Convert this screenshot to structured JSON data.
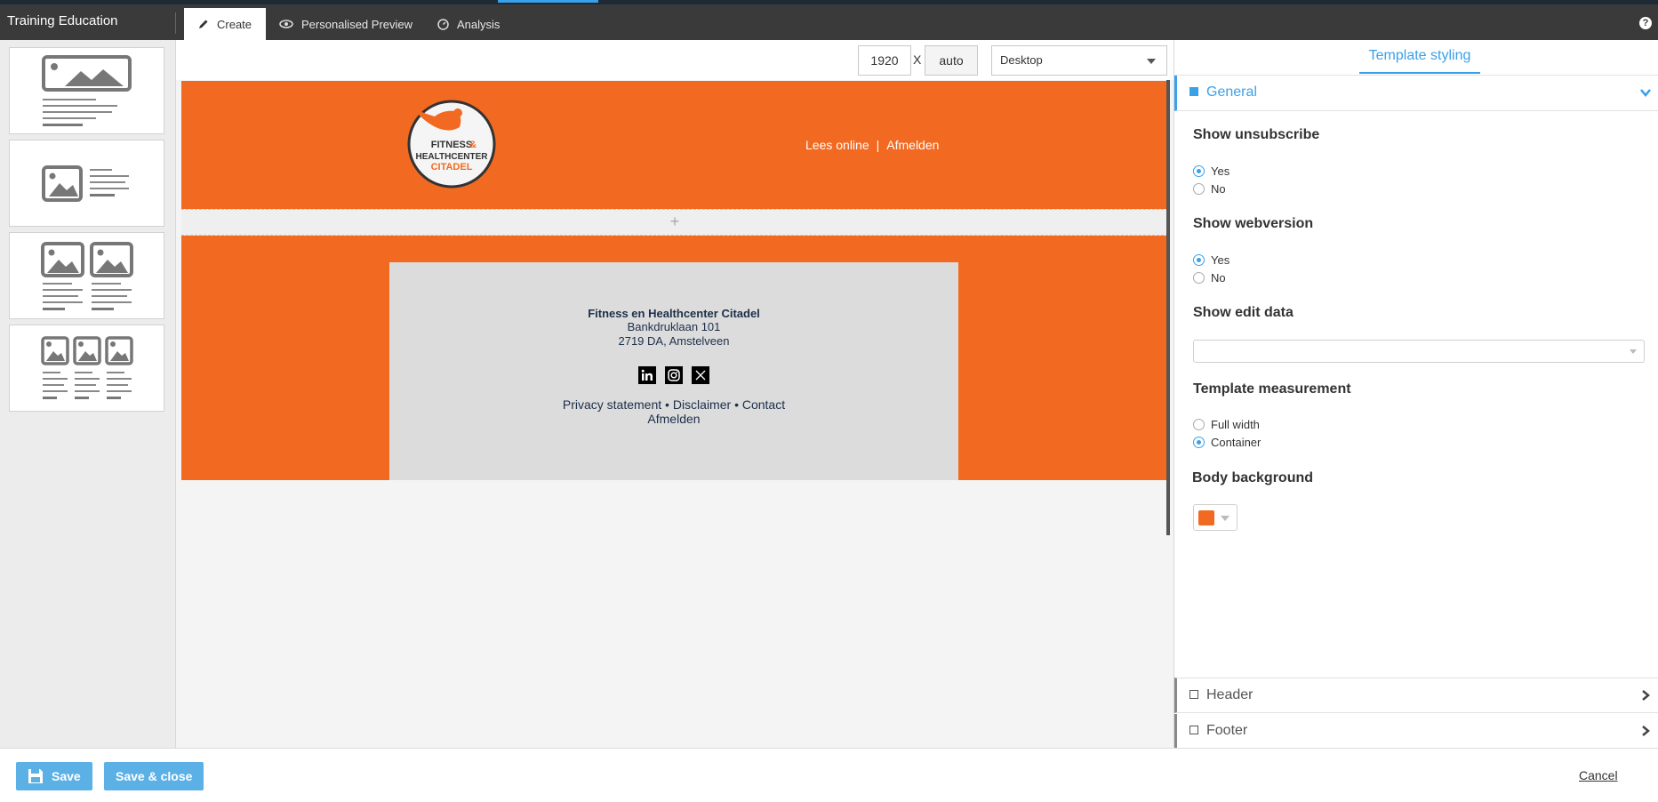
{
  "app": {
    "title": "Training Education",
    "help_label": "?"
  },
  "tabs": [
    {
      "label": "Create",
      "icon": "pencil-icon",
      "active": true
    },
    {
      "label": "Personalised Preview",
      "icon": "eye-icon",
      "active": false
    },
    {
      "label": "Analysis",
      "icon": "gauge-icon",
      "active": false
    }
  ],
  "canvas": {
    "width_value": "1920",
    "separator": "X",
    "height_value": "auto",
    "device": "Desktop"
  },
  "email": {
    "header_links": {
      "read_online": "Lees online",
      "pipe": "|",
      "unsubscribe": "Afmelden"
    },
    "add_row_symbol": "+",
    "footer": {
      "company": "Fitness en Healthcenter Citadel",
      "address_line1": "Bankdruklaan 101",
      "address_line2": "2719 DA, Amstelveen",
      "social_icons": [
        "linkedin-icon",
        "instagram-icon",
        "x-twitter-icon"
      ],
      "links": {
        "privacy": "Privacy statement",
        "disclaimer": "Disclaimer",
        "contact": "Contact",
        "separator": "•",
        "unsubscribe": "Afmelden"
      }
    },
    "colors": {
      "brand_orange": "#f26a21",
      "footer_box": "#dcdcdc"
    },
    "logo": {
      "line1": "FITNESS",
      "amp": "&",
      "line2": "HEALTHCENTER",
      "line3": "CITADEL"
    }
  },
  "styling_panel": {
    "title": "Template styling",
    "sections": {
      "general": "General",
      "header": "Header",
      "footer": "Footer"
    },
    "show_unsubscribe": {
      "label": "Show unsubscribe",
      "options": [
        "Yes",
        "No"
      ],
      "selected": "Yes"
    },
    "show_webversion": {
      "label": "Show webversion",
      "options": [
        "Yes",
        "No"
      ],
      "selected": "Yes"
    },
    "show_edit_data": {
      "label": "Show edit data",
      "value": ""
    },
    "template_measurement": {
      "label": "Template measurement",
      "options": [
        "Full width",
        "Container"
      ],
      "selected": "Container"
    },
    "body_background": {
      "label": "Body background",
      "color": "#f26a21"
    }
  },
  "footer_bar": {
    "save": "Save",
    "save_close": "Save & close",
    "cancel": "Cancel"
  },
  "accent_color": "#3aa0e8"
}
